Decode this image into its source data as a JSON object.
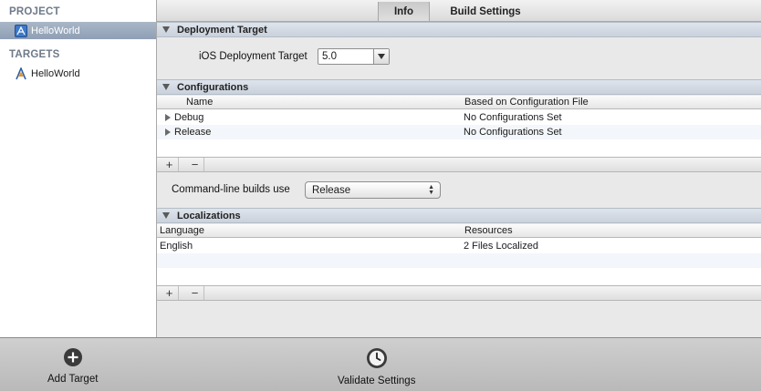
{
  "sidebar": {
    "project_header": "PROJECT",
    "project_items": [
      {
        "label": "HelloWorld",
        "icon": "project-blueprint-icon",
        "selected": true
      }
    ],
    "targets_header": "TARGETS",
    "target_items": [
      {
        "label": "HelloWorld",
        "icon": "app-target-icon",
        "selected": false
      }
    ]
  },
  "tabs": [
    {
      "label": "Info",
      "active": true
    },
    {
      "label": "Build Settings",
      "active": false
    }
  ],
  "deployment": {
    "title": "Deployment Target",
    "ios_label": "iOS Deployment Target",
    "ios_value": "5.0"
  },
  "configurations": {
    "title": "Configurations",
    "columns": [
      "Name",
      "Based on Configuration File"
    ],
    "rows": [
      {
        "name": "Debug",
        "file": "No Configurations Set"
      },
      {
        "name": "Release",
        "file": "No Configurations Set"
      }
    ],
    "add": "+",
    "remove": "−",
    "cmdline_label": "Command-line builds use",
    "cmdline_value": "Release"
  },
  "localizations": {
    "title": "Localizations",
    "columns": [
      "Language",
      "Resources"
    ],
    "rows": [
      {
        "language": "English",
        "resources": "2 Files Localized"
      }
    ],
    "add": "+",
    "remove": "−"
  },
  "toolbar": {
    "add_target": "Add Target",
    "validate": "Validate Settings"
  },
  "colors": {
    "selection": "#8f9fb4",
    "section_header": "#c9d1dc",
    "sidebar_header": "#6e7a89"
  }
}
